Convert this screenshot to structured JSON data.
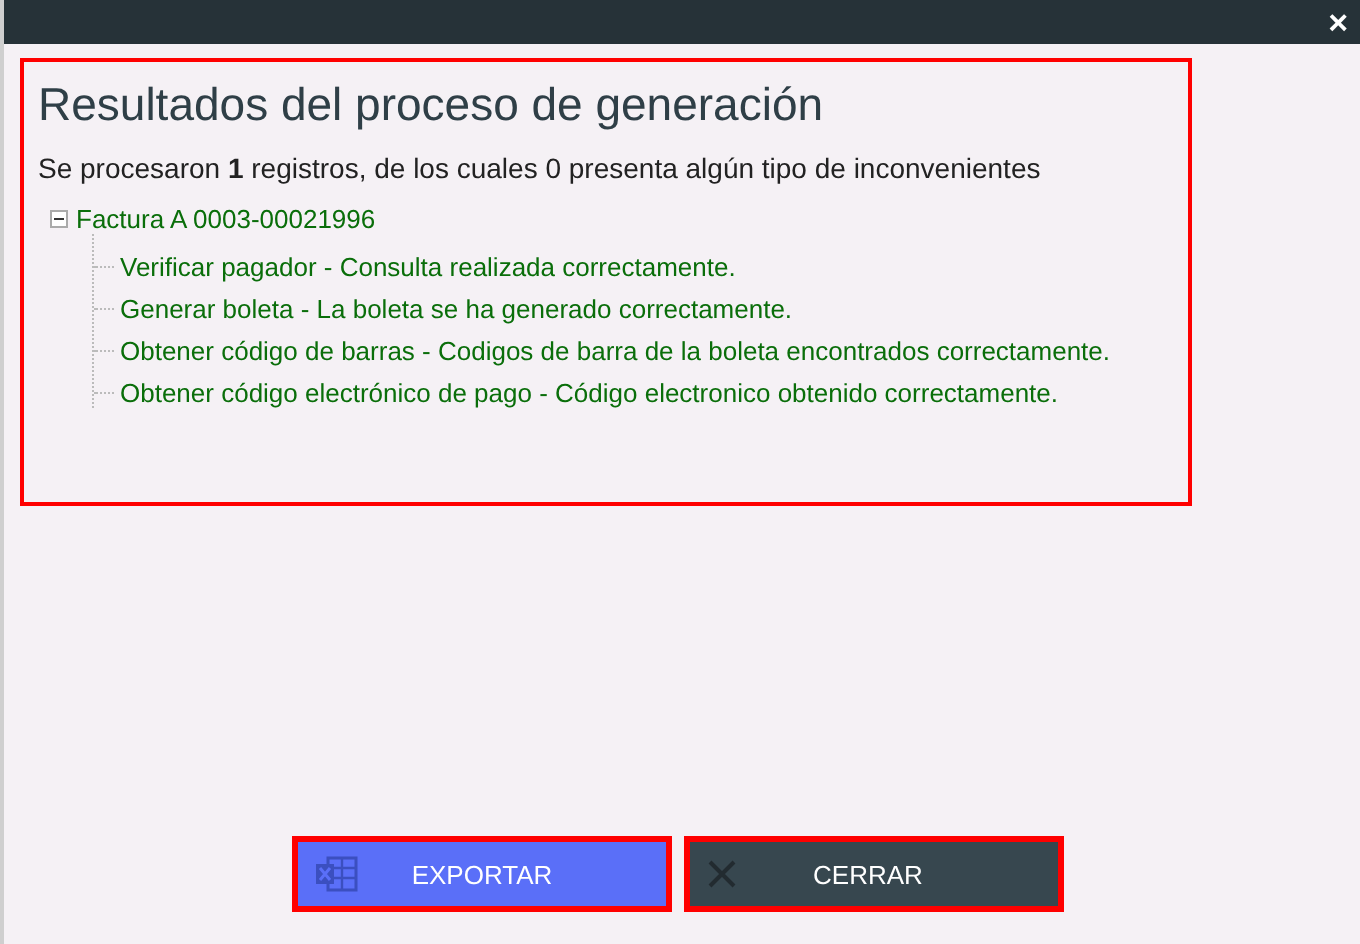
{
  "window": {
    "close": "×"
  },
  "results": {
    "title": "Resultados del proceso de generación",
    "summary": "Se procesaron **1** registros, de los cuales 0 presenta algún tipo de inconvenientes",
    "tree": [
      {
        "label": "Factura A 0003-00021996",
        "expanded": true,
        "children": [
          {
            "label": "Verificar pagador - Consulta realizada correctamente."
          },
          {
            "label": "Generar boleta - La boleta se ha generado correctamente."
          },
          {
            "label": "Obtener código de barras - Codigos de barra de la boleta encontrados correctamente."
          },
          {
            "label": "Obtener código electrónico de pago - Código electronico obtenido correctamente."
          }
        ]
      }
    ]
  },
  "buttons": [
    {
      "kind": "export",
      "label": "EXPORTAR"
    },
    {
      "kind": "close",
      "label": "CERRAR"
    }
  ]
}
